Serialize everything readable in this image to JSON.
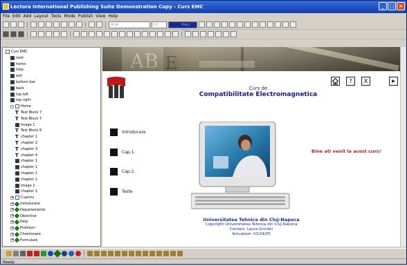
{
  "window": {
    "title": "Lectora International Publishing Suite Demonstration Copy - Curs EMC",
    "minimize": "_",
    "maximize": "□",
    "close": "×"
  },
  "menu": [
    "File",
    "Edit",
    "Add",
    "Layout",
    "Tools",
    "Mode",
    "Publish",
    "View",
    "Help"
  ],
  "toolbar": {
    "font_combo": "Arial",
    "size_combo": "10",
    "color_label": "Navy Blue"
  },
  "tree": [
    {
      "label": "Curs EMC",
      "indent": 0,
      "icon": "page"
    },
    {
      "label": "next",
      "indent": 1,
      "icon": "img"
    },
    {
      "label": "home",
      "indent": 1,
      "icon": "img"
    },
    {
      "label": "help",
      "indent": 1,
      "icon": "img"
    },
    {
      "label": "exit",
      "indent": 1,
      "icon": "img"
    },
    {
      "label": "bottom bar",
      "indent": 1,
      "icon": "img"
    },
    {
      "label": "back",
      "indent": 1,
      "icon": "img"
    },
    {
      "label": "top left",
      "indent": 1,
      "icon": "img"
    },
    {
      "label": "top right",
      "indent": 1,
      "icon": "img"
    },
    {
      "label": "Home",
      "indent": 1,
      "icon": "page",
      "exp": "-"
    },
    {
      "label": "Text Block 7",
      "indent": 2,
      "icon": "t"
    },
    {
      "label": "Text Block 7",
      "indent": 2,
      "icon": "t"
    },
    {
      "label": "Image 1",
      "indent": 2,
      "icon": "img"
    },
    {
      "label": "Text Block 8",
      "indent": 2,
      "icon": "t"
    },
    {
      "label": "chapter 1",
      "indent": 2,
      "icon": "t"
    },
    {
      "label": "chapter 2",
      "indent": 2,
      "icon": "t"
    },
    {
      "label": "chapter 3",
      "indent": 2,
      "icon": "t"
    },
    {
      "label": "chapter 4",
      "indent": 2,
      "icon": "t"
    },
    {
      "label": "chapter 1",
      "indent": 2,
      "icon": "img"
    },
    {
      "label": "chapter 1",
      "indent": 2,
      "icon": "img"
    },
    {
      "label": "chapter 1",
      "indent": 2,
      "icon": "img"
    },
    {
      "label": "chapter 1",
      "indent": 2,
      "icon": "img"
    },
    {
      "label": "Image 2",
      "indent": 2,
      "icon": "img"
    },
    {
      "label": "chapter 1",
      "indent": 2,
      "icon": "img"
    },
    {
      "label": "Cuprins",
      "indent": 1,
      "icon": "page",
      "exp": "+"
    },
    {
      "label": "Introducere",
      "indent": 1,
      "icon": "green",
      "exp": "+"
    },
    {
      "label": "Departamente",
      "indent": 1,
      "icon": "green",
      "exp": "+"
    },
    {
      "label": "Obiective",
      "indent": 1,
      "icon": "green",
      "exp": "+"
    },
    {
      "label": "Help",
      "indent": 1,
      "icon": "green",
      "exp": "+"
    },
    {
      "label": "Profesori",
      "indent": 1,
      "icon": "green",
      "exp": "+"
    },
    {
      "label": "Chestionare",
      "indent": 1,
      "icon": "green",
      "exp": "+"
    },
    {
      "label": "Formulare",
      "indent": 1,
      "icon": "green",
      "exp": "+"
    }
  ],
  "page": {
    "course_line1": "Curs de",
    "course_line2": "Compatibilitate Electromagnetica",
    "menu_items": [
      "Introducere",
      "Cap.1.",
      "Cap.2.",
      "Teste"
    ],
    "welcome": "Bine ati venit la acest curs!",
    "university": "Universitatea Tehnica din Cluj-Napoca",
    "copyright": "Copyright Universitatea Tehnica din Cluj-Napoca",
    "contact": "Contact: Laura Grindei",
    "updated": "Actualizat: 03/24/05",
    "nav_help": "?",
    "nav_exit": "X",
    "nav_next": "▶"
  },
  "status": "Ready",
  "colors": {
    "title_bar": "#1c4fc4",
    "course_text": "#1a1a80",
    "welcome_text": "#b02020"
  }
}
